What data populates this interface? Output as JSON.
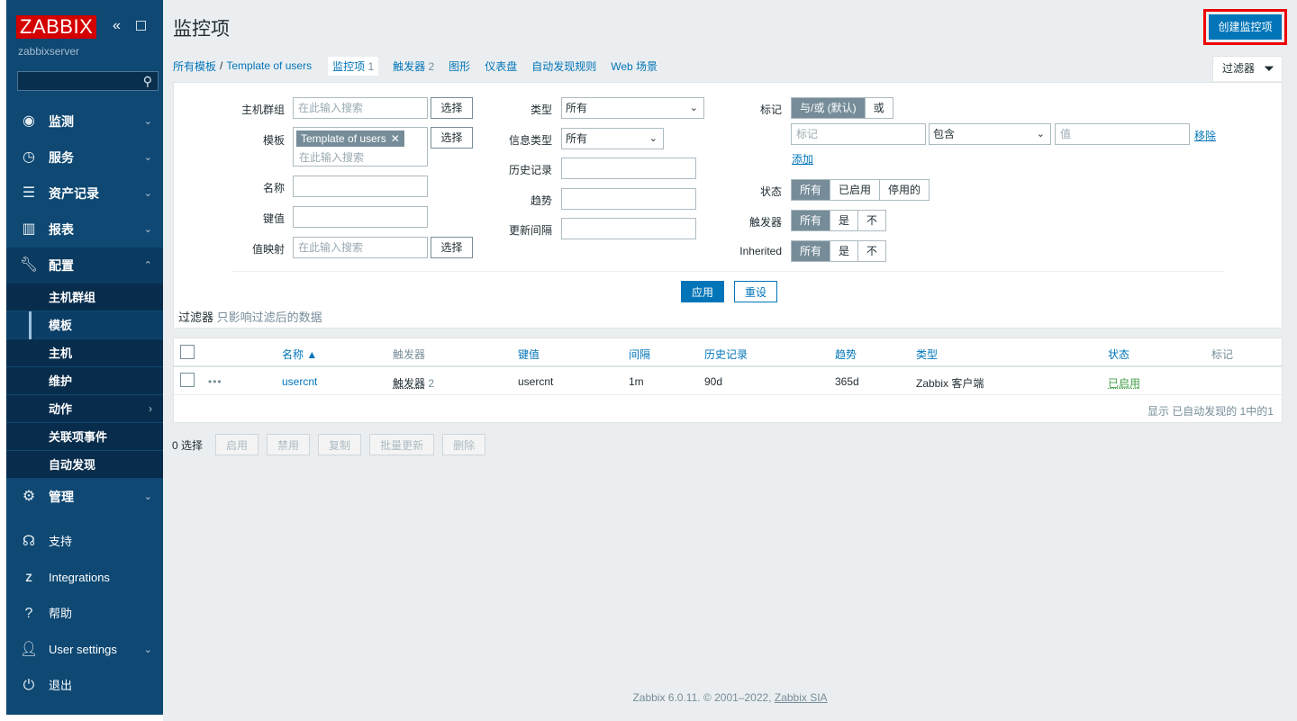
{
  "sidebar": {
    "logo": "ZABBIX",
    "server": "zabbixserver",
    "menu": [
      {
        "label": "监测",
        "icon": "eye-icon"
      },
      {
        "label": "服务",
        "icon": "clock-icon"
      },
      {
        "label": "资产记录",
        "icon": "list-icon"
      },
      {
        "label": "报表",
        "icon": "bar-chart-icon"
      },
      {
        "label": "配置",
        "icon": "wrench-icon"
      }
    ],
    "submenu": [
      "主机群组",
      "模板",
      "主机",
      "维护",
      "动作",
      "关联项事件",
      "自动发现"
    ],
    "admin": "管理",
    "bottom": [
      {
        "label": "支持",
        "icon": "headset-icon"
      },
      {
        "label": "Integrations",
        "icon": "zabbix-z-icon"
      },
      {
        "label": "帮助",
        "icon": "question-icon"
      },
      {
        "label": "User settings",
        "icon": "user-icon"
      },
      {
        "label": "退出",
        "icon": "power-icon"
      }
    ]
  },
  "header": {
    "title": "监控项",
    "create_button": "创建监控项"
  },
  "breadcrumbs": {
    "all_templates": "所有模板",
    "separator": "/",
    "template": "Template of users",
    "tabs": [
      {
        "label": "监控项",
        "count": "1"
      },
      {
        "label": "触发器",
        "count": "2"
      },
      {
        "label": "图形",
        "count": ""
      },
      {
        "label": "仪表盘",
        "count": ""
      },
      {
        "label": "自动发现规则",
        "count": ""
      },
      {
        "label": "Web 场景",
        "count": ""
      }
    ]
  },
  "filter": {
    "tab_label": "过滤器",
    "host_groups_label": "主机群组",
    "search_placeholder": "在此输入搜索",
    "select_button": "选择",
    "templates_label": "模板",
    "template_chip": "Template of users",
    "name_label": "名称",
    "key_label": "键值",
    "value_map_label": "值映射",
    "type_label": "类型",
    "type_value": "所有",
    "info_type_label": "信息类型",
    "info_type_value": "所有",
    "history_label": "历史记录",
    "trends_label": "趋势",
    "update_interval_label": "更新间隔",
    "tags_label": "标记",
    "tags_and_or": "与/或 (默认)",
    "tags_or": "或",
    "tag_placeholder": "标记",
    "tag_op_value": "包含",
    "tag_value_placeholder": "值",
    "remove_link": "移除",
    "add_link": "添加",
    "status_label": "状态",
    "status_options": [
      "所有",
      "已启用",
      "停用的"
    ],
    "triggers_label": "触发器",
    "triggers_options": [
      "所有",
      "是",
      "不"
    ],
    "inherited_label": "Inherited",
    "inherited_options": [
      "所有",
      "是",
      "不"
    ],
    "apply": "应用",
    "reset": "重设",
    "note_prefix": "过滤器",
    "note_text": "只影响过滤后的数据"
  },
  "table": {
    "headers": [
      "名称 ▲",
      "触发器",
      "键值",
      "间隔",
      "历史记录",
      "趋势",
      "类型",
      "状态",
      "标记"
    ],
    "row": {
      "menu": "•••",
      "name": "usercnt",
      "triggers_label": "触发器",
      "triggers_count": "2",
      "key": "usercnt",
      "interval": "1m",
      "history": "90d",
      "trends": "365d",
      "type": "Zabbix 客户端",
      "status": "已启用",
      "status_color": "#429e47"
    },
    "footer_info": "显示 已自动发现的 1中的1"
  },
  "actions": {
    "selected": "0 选择",
    "buttons": [
      "启用",
      "禁用",
      "复制",
      "批量更新",
      "删除"
    ]
  },
  "footer": {
    "text": "Zabbix 6.0.11. © 2001–2022,",
    "link": "Zabbix SIA"
  }
}
